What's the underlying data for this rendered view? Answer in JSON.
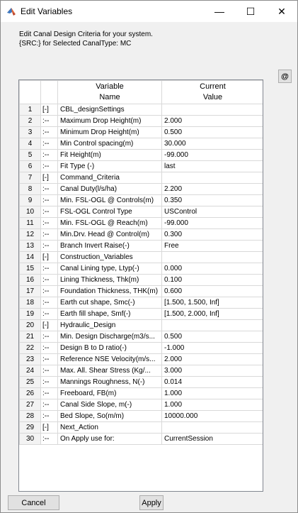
{
  "window": {
    "title": "Edit Variables",
    "minimize": "—",
    "maximize": "☐",
    "close": "✕"
  },
  "description": {
    "line1": "Edit Canal Design Criteria for your system.",
    "line2": "{SRC:} for Selected CanalType: MC"
  },
  "at_button": "@",
  "table": {
    "headers": {
      "variable": "Variable\nName",
      "value": "Current\nValue"
    },
    "rows": [
      {
        "n": "1",
        "mark": "[-]",
        "name": "CBL_designSettings",
        "value": ""
      },
      {
        "n": "2",
        "mark": ":--",
        "name": "Maximum Drop Height(m)",
        "value": "2.000"
      },
      {
        "n": "3",
        "mark": ":--",
        "name": "Minimum Drop Height(m)",
        "value": "0.500"
      },
      {
        "n": "4",
        "mark": ":--",
        "name": "Min Control spacing(m)",
        "value": "30.000"
      },
      {
        "n": "5",
        "mark": ":--",
        "name": "Fit Height(m)",
        "value": "-99.000"
      },
      {
        "n": "6",
        "mark": ":--",
        "name": "Fit Type (-)",
        "value": "last"
      },
      {
        "n": "7",
        "mark": "[-]",
        "name": "Command_Criteria",
        "value": ""
      },
      {
        "n": "8",
        "mark": ":--",
        "name": "Canal Duty(l/s/ha)",
        "value": "2.200"
      },
      {
        "n": "9",
        "mark": ":--",
        "name": "Min. FSL-OGL @ Controls(m)",
        "value": "0.350"
      },
      {
        "n": "10",
        "mark": ":--",
        "name": "FSL-OGL Control Type",
        "value": "USControl"
      },
      {
        "n": "11",
        "mark": ":--",
        "name": "Min. FSL-OGL @ Reach(m)",
        "value": "-99.000"
      },
      {
        "n": "12",
        "mark": ":--",
        "name": "Min.Drv. Head @ Control(m)",
        "value": "0.300"
      },
      {
        "n": "13",
        "mark": ":--",
        "name": "Branch Invert Raise(-)",
        "value": "Free"
      },
      {
        "n": "14",
        "mark": "[-]",
        "name": "Construction_Variables",
        "value": ""
      },
      {
        "n": "15",
        "mark": ":--",
        "name": "Canal Lining type, Ltyp(-)",
        "value": "0.000"
      },
      {
        "n": "16",
        "mark": ":--",
        "name": "Lining Thickness, Thk(m)",
        "value": "0.100"
      },
      {
        "n": "17",
        "mark": ":--",
        "name": "Foundation Thickness, THK(m)",
        "value": "0.600"
      },
      {
        "n": "18",
        "mark": ":--",
        "name": "Earth cut shape, Smc(-)",
        "value": "[1.500, 1.500, Inf]"
      },
      {
        "n": "19",
        "mark": ":--",
        "name": "Earth fill shape, Smf(-)",
        "value": "[1.500, 2.000, Inf]"
      },
      {
        "n": "20",
        "mark": "[-]",
        "name": "Hydraulic_Design",
        "value": ""
      },
      {
        "n": "21",
        "mark": ":--",
        "name": "Min. Design Discharge(m3/s...",
        "value": "0.500"
      },
      {
        "n": "22",
        "mark": ":--",
        "name": "Design B to D ratio(-)",
        "value": "-1.000"
      },
      {
        "n": "23",
        "mark": ":--",
        "name": "Reference NSE Velocity(m/s...",
        "value": "2.000"
      },
      {
        "n": "24",
        "mark": ":--",
        "name": "Max. All. Shear Stress (Kg/...",
        "value": "3.000"
      },
      {
        "n": "25",
        "mark": ":--",
        "name": "Mannings Roughness, N(-)",
        "value": "0.014"
      },
      {
        "n": "26",
        "mark": ":--",
        "name": "Freeboard, FB(m)",
        "value": "1.000"
      },
      {
        "n": "27",
        "mark": ":--",
        "name": "Canal Side Slope, m(-)",
        "value": "1.000"
      },
      {
        "n": "28",
        "mark": ":--",
        "name": "Bed Slope, So(m/m)",
        "value": "10000.000"
      },
      {
        "n": "29",
        "mark": "[-]",
        "name": "Next_Action",
        "value": ""
      },
      {
        "n": "30",
        "mark": ":--",
        "name": "On Apply use for:",
        "value": "CurrentSession"
      }
    ]
  },
  "buttons": {
    "cancel": "Cancel",
    "apply": "Apply"
  },
  "icons": {
    "app": "matlab-icon"
  }
}
